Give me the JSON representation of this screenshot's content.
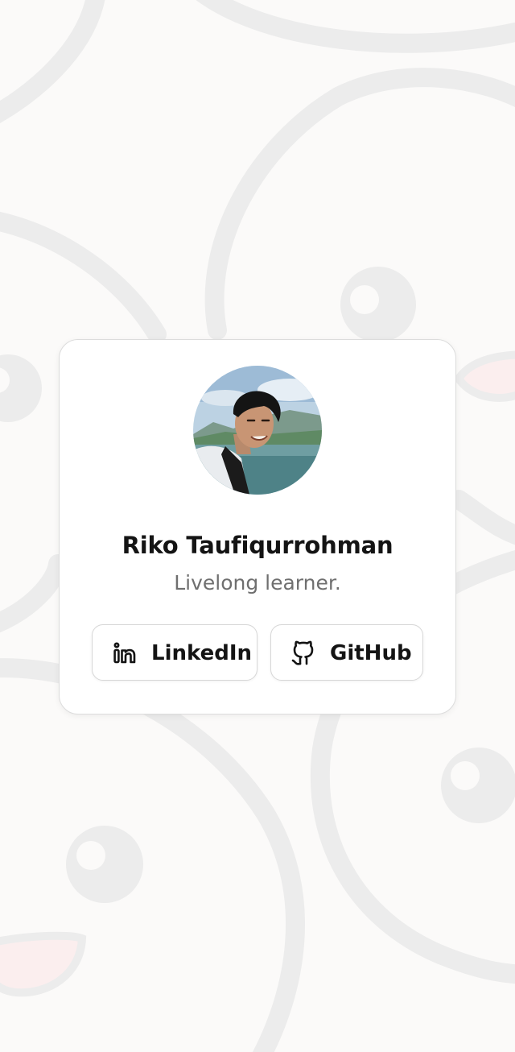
{
  "profile": {
    "name": "Riko Taufiqurrohman",
    "tagline": "Livelong learner."
  },
  "links": {
    "linkedin": {
      "label": "LinkedIn",
      "icon": "linkedin-icon"
    },
    "github": {
      "label": "GitHub",
      "icon": "github-icon"
    }
  },
  "colors": {
    "background": "#fbfaf9",
    "pattern": "#ececec",
    "card": "#ffffff",
    "name": "#141414",
    "tagline": "#6f6f6f"
  }
}
